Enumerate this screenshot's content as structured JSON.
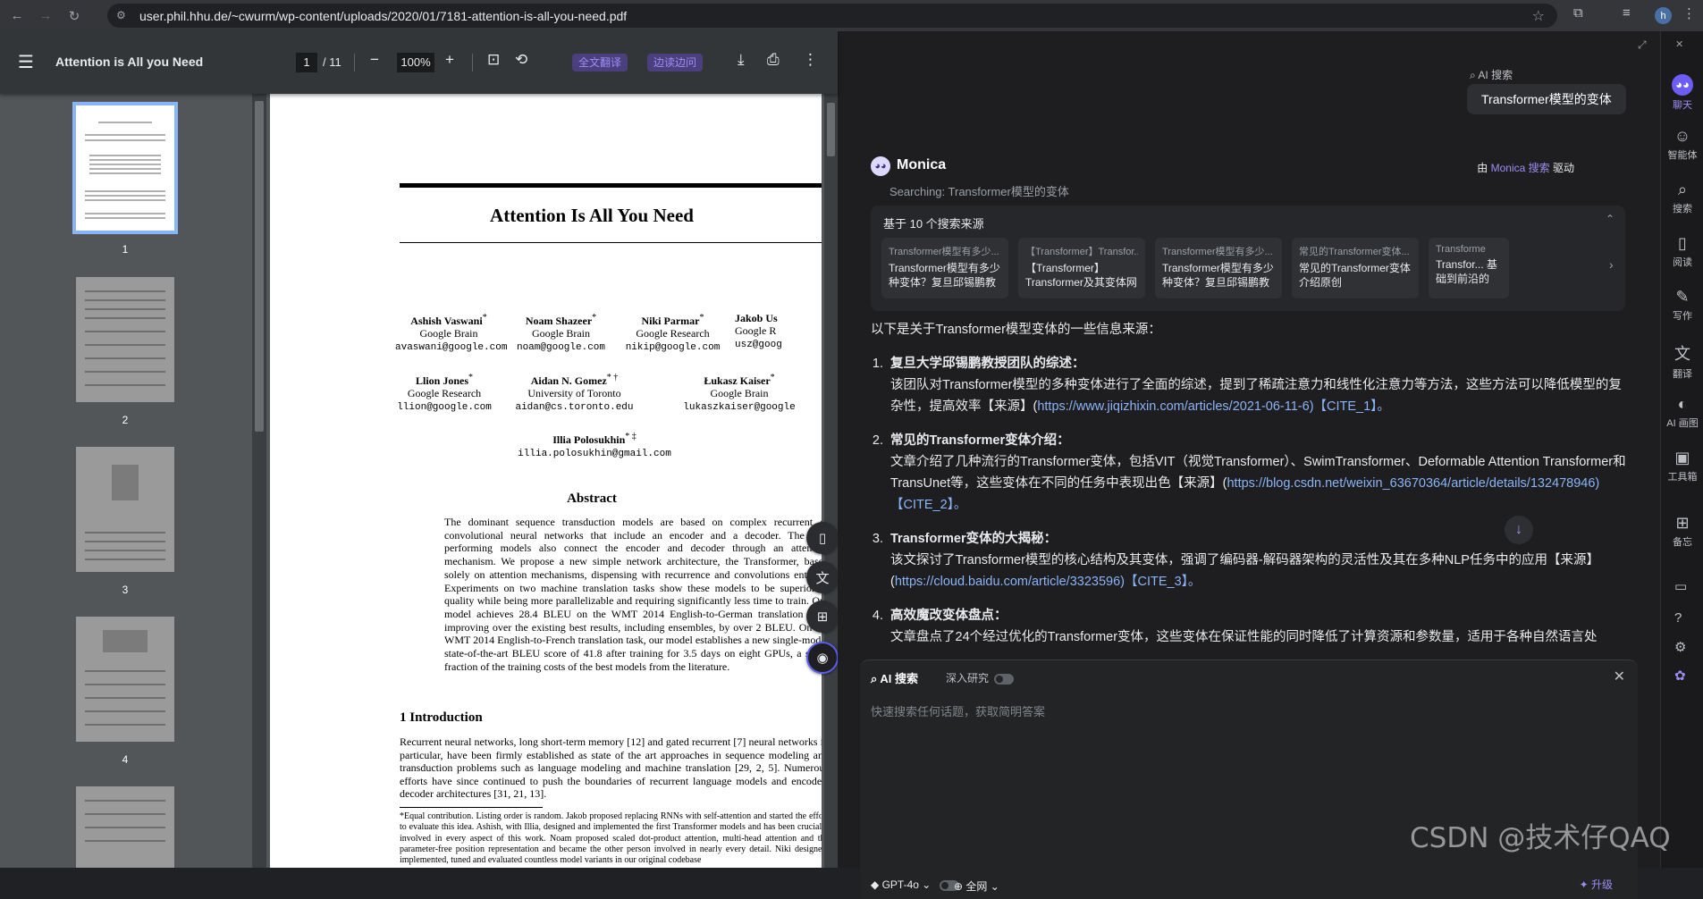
{
  "browser": {
    "url": "user.phil.hhu.de/~cwurm/wp-content/uploads/2020/01/7181-attention-is-all-you-need.pdf",
    "profile_initial": "h"
  },
  "pdf": {
    "title": "Attention is All you Need",
    "page_current": "1",
    "page_total": "/ 11",
    "zoom": "100%",
    "translate_label": "全文翻译",
    "side_translate_label": "边读边问",
    "thumbnail_labels": [
      "1",
      "2",
      "3",
      "4"
    ],
    "paper": {
      "title": "Attention Is All You Need",
      "authors": [
        {
          "name": "Ashish Vaswani",
          "mark": "*",
          "affil": "Google Brain",
          "email": "avaswani@google.com"
        },
        {
          "name": "Noam Shazeer",
          "mark": "*",
          "affil": "Google Brain",
          "email": "noam@google.com"
        },
        {
          "name": "Niki Parmar",
          "mark": "*",
          "affil": "Google Research",
          "email": "nikip@google.com"
        },
        {
          "name": "Jakob Us",
          "mark": "",
          "affil": "Google R",
          "email": "usz@goog"
        },
        {
          "name": "Llion Jones",
          "mark": "*",
          "affil": "Google Research",
          "email": "llion@google.com"
        },
        {
          "name": "Aidan N. Gomez",
          "mark": "* †",
          "affil": "University of Toronto",
          "email": "aidan@cs.toronto.edu"
        },
        {
          "name": "Łukasz Kaiser",
          "mark": "*",
          "affil": "Google Brain",
          "email": "lukaszkaiser@google"
        },
        {
          "name": "Illia Polosukhin",
          "mark": "* ‡",
          "affil": "",
          "email": "illia.polosukhin@gmail.com"
        }
      ],
      "abstract_title": "Abstract",
      "abstract": "The dominant sequence transduction models are based on complex recurrent or convolutional neural networks that include an encoder and a decoder. The best performing models also connect the encoder and decoder through an attention mechanism. We propose a new simple network architecture, the Transformer, based solely on attention mechanisms, dispensing with recurrence and convolutions entirely. Experiments on two machine translation tasks show these models to be superior in quality while being more parallelizable and requiring significantly less time to train. Our model achieves 28.4 BLEU on the WMT 2014 English-to-German translation task, improving over the existing best results, including ensembles, by over 2 BLEU. On the WMT 2014 English-to-French translation task, our model establishes a new single-model state-of-the-art BLEU score of 41.8 after training for 3.5 days on eight GPUs, a small fraction of the training costs of the best models from the literature.",
      "section_title": "1    Introduction",
      "intro": "Recurrent neural networks, long short-term memory [12] and gated recurrent [7] neural networks in particular, have been firmly established as state of the art approaches in sequence modeling and transduction problems such as language modeling and machine translation [29, 2, 5]. Numerous efforts have since continued to push the boundaries of recurrent language models and encoder-decoder architectures [31, 21, 13].",
      "footnote": "*Equal contribution. Listing order is random. Jakob proposed replacing RNNs with self-attention and started the effort to evaluate this idea. Ashish, with Illia, designed and implemented the first Transformer models and has been crucially involved in every aspect of this work. Noam proposed scaled dot-product attention, multi-head attention and the parameter-free position representation and became the other person involved in nearly every detail. Niki designed, implemented, tuned and evaluated countless model variants in our original codebase"
    }
  },
  "monica": {
    "query_label": "AI 搜索",
    "query": "Transformer模型的变体",
    "assistant_name": "Monica",
    "powered_prefix": "由",
    "powered_name": "Monica 搜索",
    "powered_suffix": "驱动",
    "searching": "Searching: Transformer模型的变体",
    "sources_header": "基于 10 个搜索来源",
    "sources": [
      {
        "title": "Transformer模型有多少...",
        "desc": "Transformer模型有多少种变体？复旦邱锡鹏教授团队做..."
      },
      {
        "title": "【Transformer】Transfor...",
        "desc": "【Transformer】Transformer及其变体网络介绍原创"
      },
      {
        "title": "Transformer模型有多少...",
        "desc": "Transformer模型有多少种变体？复旦邱锡鹏教授团队做..."
      },
      {
        "title": "常见的Transformer变体...",
        "desc": "常见的Transformer变体介绍原创"
      },
      {
        "title": "Transforme",
        "desc": "Transfor... 基础到前沿的"
      }
    ],
    "intro_line": "以下是关于Transformer模型变体的一些信息来源：",
    "items": [
      {
        "label": "复旦大学邱锡鹏教授团队的综述：",
        "text": "该团队对Transformer模型的多种变体进行了全面的综述，提到了稀疏注意力和线性化注意力等方法，这些方法可以降低模型的复杂性，提高效率【来源】(",
        "link": "https://www.jiqizhixin.com/articles/2021-06-11-6",
        "cite": ")【CITE_1】。"
      },
      {
        "label": "常见的Transformer变体介绍：",
        "text": "文章介绍了几种流行的Transformer变体，包括VIT（视觉Transformer）、SwimTransformer、Deformable Attention Transformer和TransUnet等，这些变体在不同的任务中表现出色【来源】(",
        "link": "https://blog.csdn.net/weixin_63670364/article/details/132478946",
        "cite": ")【CITE_2】。"
      },
      {
        "label": "Transformer变体的大揭秘：",
        "text": "该文探讨了Transformer模型的核心结构及其变体，强调了编码器-解码器架构的灵活性及其在多种NLP任务中的应用【来源】(",
        "link": "https://cloud.baidu.com/article/3323596",
        "cite": ")【CITE_3】。"
      },
      {
        "label": "高效魔改变体盘点：",
        "text": "文章盘点了24个经过优化的Transformer变体，这些变体在保证性能的同时降低了计算资源和参数量，适用于各种自然语言处",
        "link": "",
        "cite": ""
      }
    ],
    "input": {
      "mode": "AI 搜索",
      "deep": "深入研究",
      "placeholder": "快速搜索任何话题，获取简明答案",
      "model": "GPT-4o",
      "net": "全网",
      "upgrade": "升级"
    }
  },
  "sidebar": [
    {
      "label": "聊天",
      "icon": "chat-icon"
    },
    {
      "label": "智能体",
      "icon": "agent-icon"
    },
    {
      "label": "搜索",
      "icon": "search-icon"
    },
    {
      "label": "阅读",
      "icon": "book-icon"
    },
    {
      "label": "写作",
      "icon": "pen-icon"
    },
    {
      "label": "翻译",
      "icon": "translate-icon"
    },
    {
      "label": "AI 画图",
      "icon": "palette-icon"
    },
    {
      "label": "工具箱",
      "icon": "toolbox-icon"
    },
    {
      "label": "备忘",
      "icon": "memo-icon"
    }
  ],
  "watermark": "CSDN @技术仔QAQ",
  "colors": {
    "accent": "#6e5cf6",
    "link": "#8ab4f8"
  }
}
